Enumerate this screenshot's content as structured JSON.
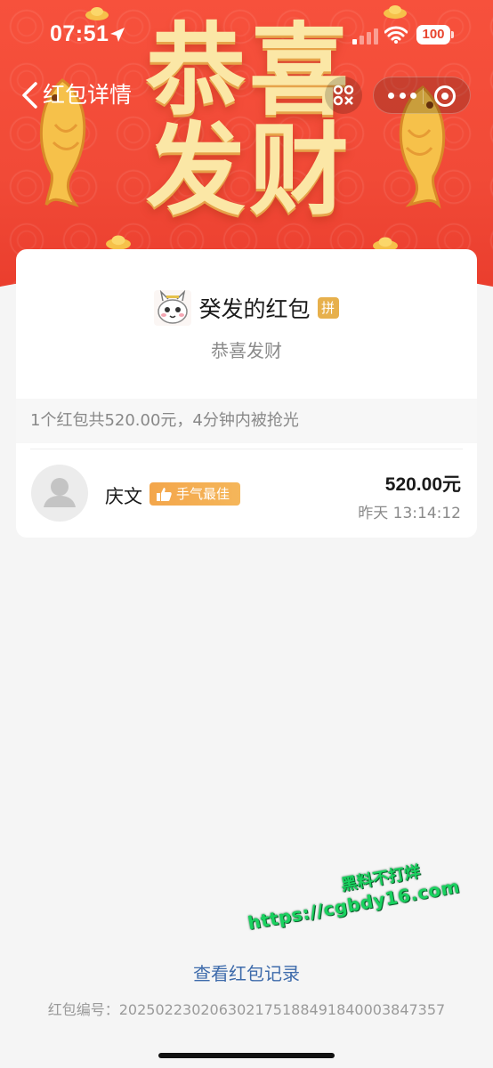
{
  "status_bar": {
    "time": "07:51",
    "battery": "100"
  },
  "nav": {
    "title": "红包详情"
  },
  "banner": {
    "title_line1": "恭喜",
    "title_line2": "发财"
  },
  "packet": {
    "sender": "癸发的红包",
    "type_badge": "拼",
    "greeting": "恭喜发财",
    "summary": "1个红包共520.00元，4分钟内被抢光"
  },
  "receivers": [
    {
      "name": "庆文",
      "badge": "手气最佳",
      "amount": "520.00元",
      "time": "昨天 13:14:12"
    }
  ],
  "footer": {
    "record_link": "查看红包记录",
    "serial": "红包编号：2025022302063021751884918400038473​57"
  },
  "watermark": {
    "line1": "黑料不打烊",
    "line2": "https://cgbdy16.com"
  },
  "colors": {
    "header_red": "#f14a37",
    "gold": "#fbe7a6",
    "link_blue": "#3e6bab",
    "badge_orange": "#f3a64b"
  }
}
